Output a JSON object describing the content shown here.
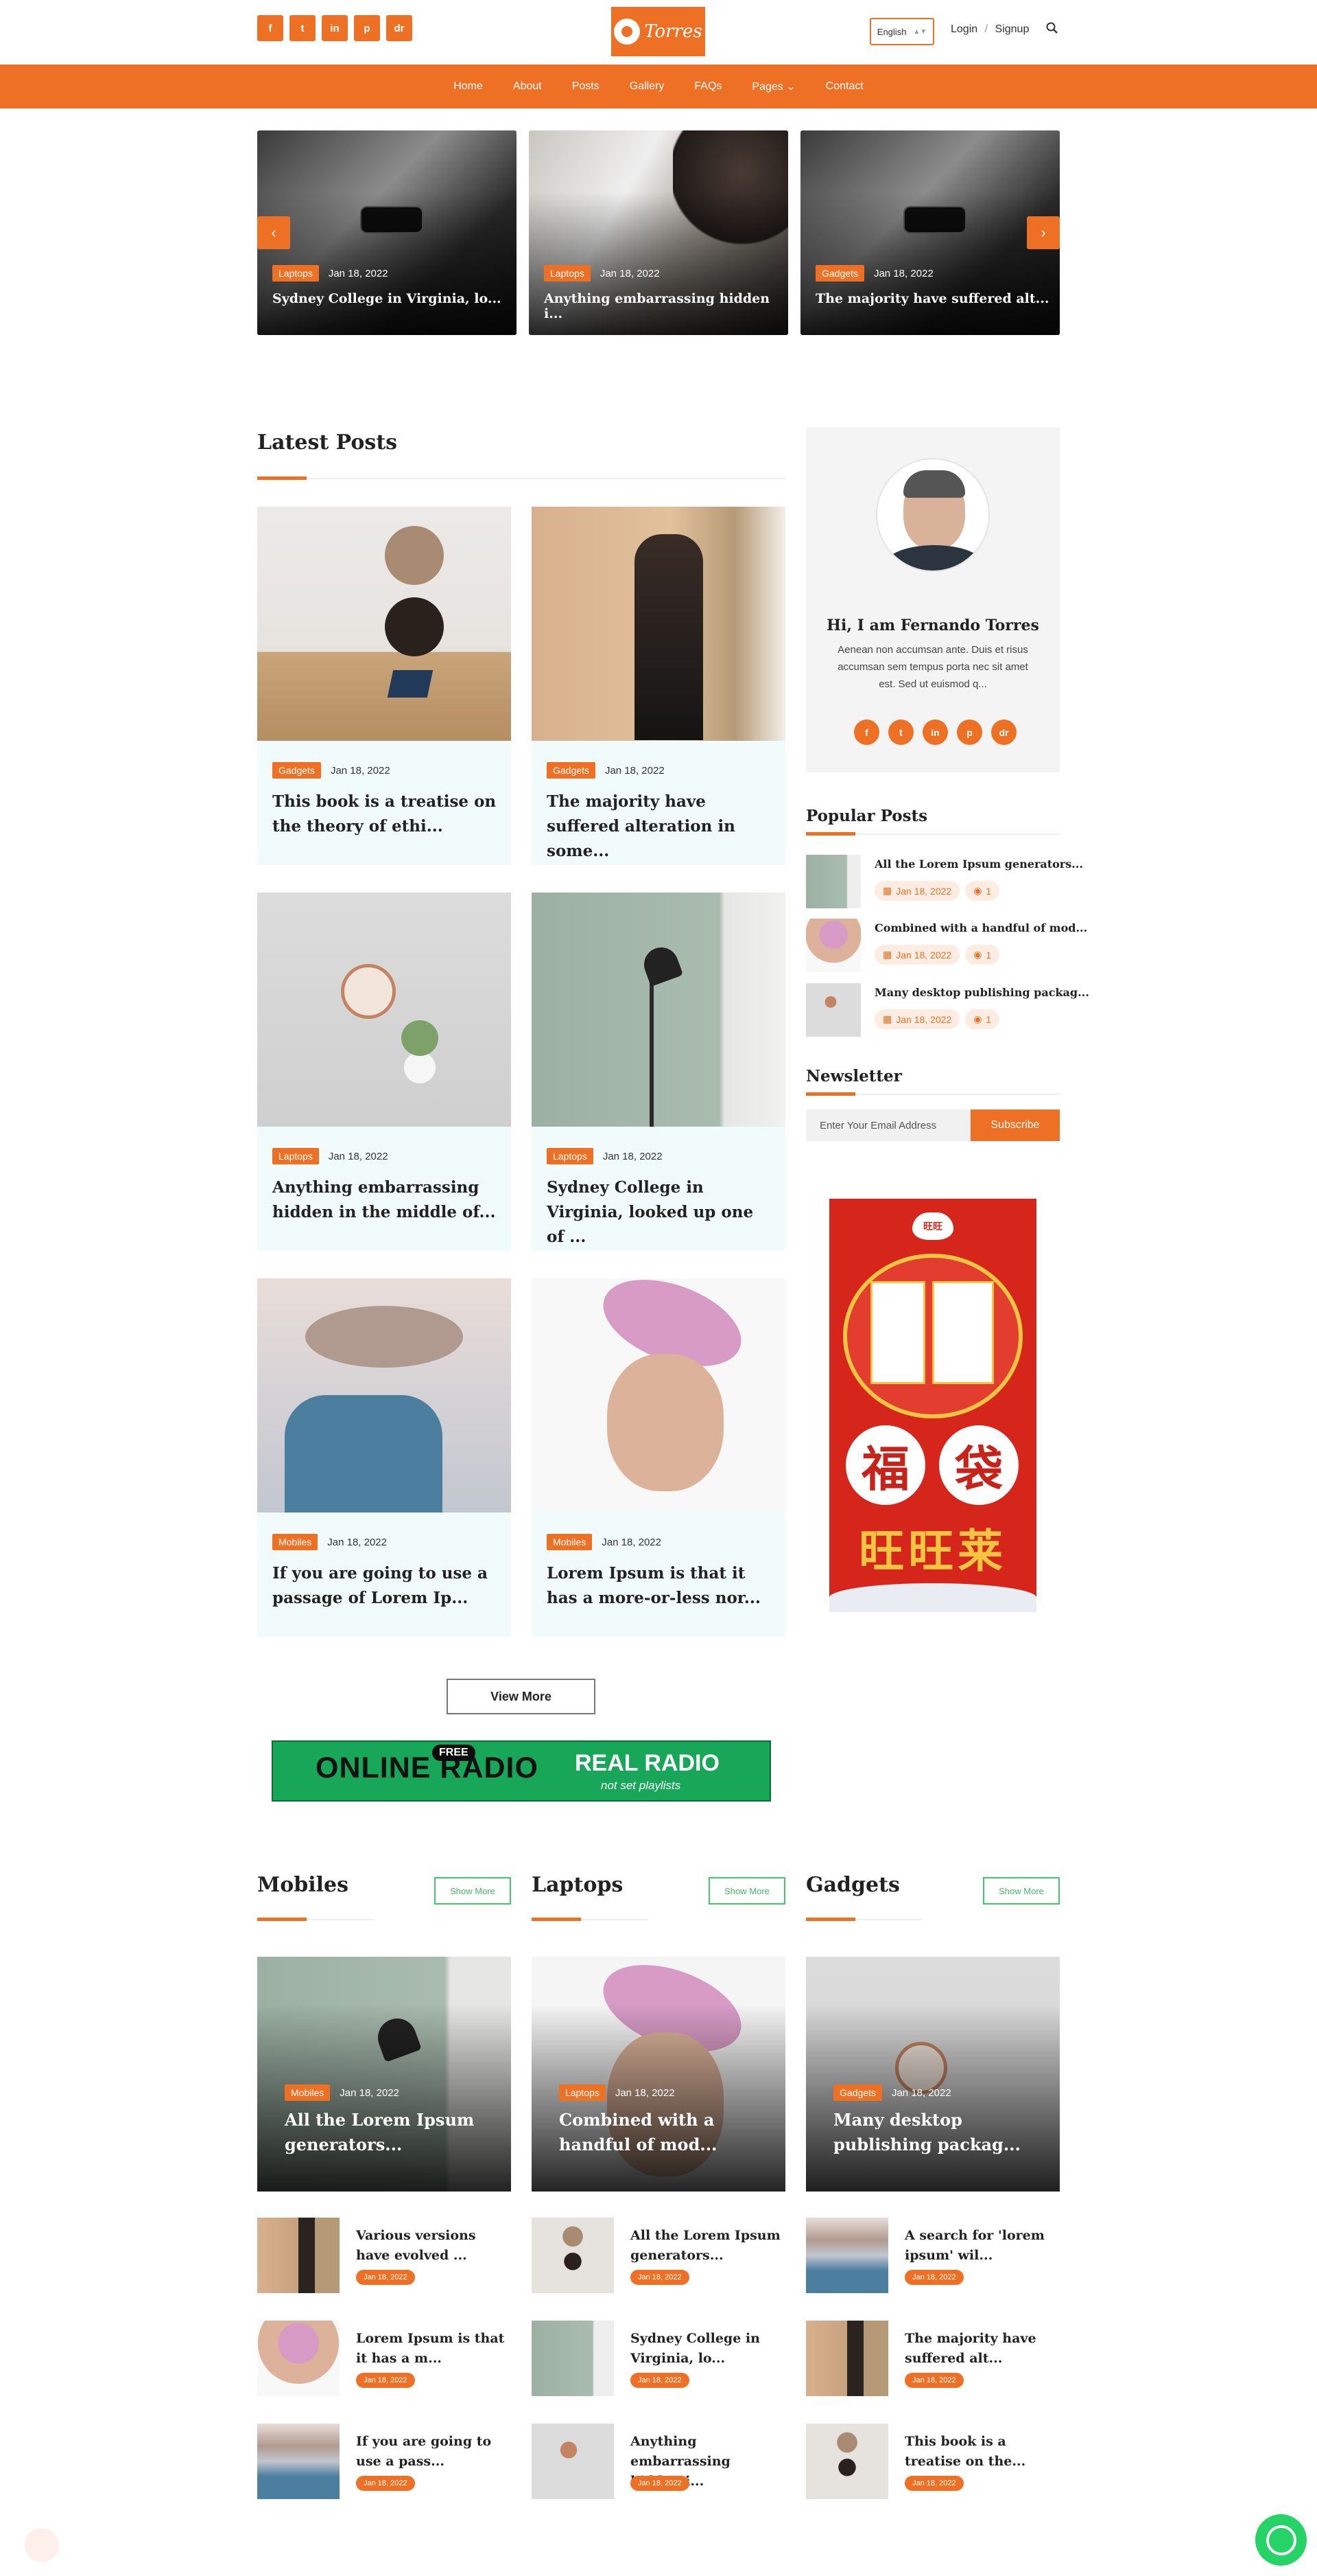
{
  "header": {
    "social": [
      "f",
      "t",
      "in",
      "p",
      "dr"
    ],
    "logo": "Torres",
    "language": "English",
    "login": "Login",
    "separator": "/",
    "signup": "Signup"
  },
  "nav": [
    "Home",
    "About",
    "Posts",
    "Gallery",
    "FAQs",
    "Pages",
    "Contact"
  ],
  "slider": [
    {
      "tag": "Laptops",
      "date": "Jan 18, 2022",
      "title": "Sydney College in Virginia, lo..."
    },
    {
      "tag": "Laptops",
      "date": "Jan 18, 2022",
      "title": "Anything embarrassing hidden i..."
    },
    {
      "tag": "Gadgets",
      "date": "Jan 18, 2022",
      "title": "The majority have suffered alt..."
    }
  ],
  "latest": {
    "title": "Latest Posts",
    "posts": [
      {
        "tag": "Gadgets",
        "date": "Jan 18, 2022",
        "title": "This book is a treatise on the theory of ethi..."
      },
      {
        "tag": "Gadgets",
        "date": "Jan 18, 2022",
        "title": "The majority have suffered alteration in some..."
      },
      {
        "tag": "Laptops",
        "date": "Jan 18, 2022",
        "title": "Anything embarrassing hidden in the middle of..."
      },
      {
        "tag": "Laptops",
        "date": "Jan 18, 2022",
        "title": "Sydney College in Virginia, looked up one of ..."
      },
      {
        "tag": "Mobiles",
        "date": "Jan 18, 2022",
        "title": "If you are going to use a passage of Lorem Ip..."
      },
      {
        "tag": "Mobiles",
        "date": "Jan 18, 2022",
        "title": "Lorem Ipsum is that it has a more-or-less nor..."
      }
    ],
    "view_more": "View More"
  },
  "radio_banner": {
    "free": "FREE",
    "left": "ONLINE RADIO",
    "right": "REAL RADIO",
    "sub": "not set playlists"
  },
  "about": {
    "name": "Hi, I am Fernando Torres",
    "bio": "Aenean non accumsan ante. Duis et risus accumsan sem tempus porta nec sit amet est. Sed ut euismod q..."
  },
  "popular": {
    "title": "Popular Posts",
    "items": [
      {
        "title": "All the Lorem Ipsum generators...",
        "date": "Jan 18, 2022",
        "views": "1"
      },
      {
        "title": "Combined with a handful of mod...",
        "date": "Jan 18, 2022",
        "views": "1"
      },
      {
        "title": "Many desktop publishing packag...",
        "date": "Jan 18, 2022",
        "views": "1"
      }
    ]
  },
  "newsletter": {
    "title": "Newsletter",
    "placeholder": "Enter Your Email Address",
    "button": "Subscribe"
  },
  "ad": {
    "brand": "旺旺",
    "big1": "福",
    "big2": "袋",
    "bottom": "旺旺莱"
  },
  "categories": [
    {
      "title": "Mobiles",
      "show_more": "Show More",
      "featured": {
        "tag": "Mobiles",
        "date": "Jan 18, 2022",
        "title": "All the Lorem Ipsum generators..."
      },
      "items": [
        {
          "title": "Various versions have evolved ...",
          "date": "Jan 18, 2022"
        },
        {
          "title": "Lorem Ipsum is that it has a m...",
          "date": "Jan 18, 2022"
        },
        {
          "title": "If you are going to use a pass...",
          "date": "Jan 18, 2022"
        }
      ]
    },
    {
      "title": "Laptops",
      "show_more": "Show More",
      "featured": {
        "tag": "Laptops",
        "date": "Jan 18, 2022",
        "title": "Combined with a handful of mod..."
      },
      "items": [
        {
          "title": "All the Lorem Ipsum generators...",
          "date": "Jan 18, 2022"
        },
        {
          "title": "Sydney College in Virginia, lo...",
          "date": "Jan 18, 2022"
        },
        {
          "title": "Anything embarrassing hidden i...",
          "date": "Jan 18, 2022"
        }
      ]
    },
    {
      "title": "Gadgets",
      "show_more": "Show More",
      "featured": {
        "tag": "Gadgets",
        "date": "Jan 18, 2022",
        "title": "Many desktop publishing packag..."
      },
      "items": [
        {
          "title": "A search for 'lorem ipsum' wil...",
          "date": "Jan 18, 2022"
        },
        {
          "title": "The majority have suffered alt...",
          "date": "Jan 18, 2022"
        },
        {
          "title": "This book is a treatise on the...",
          "date": "Jan 18, 2022"
        }
      ]
    }
  ],
  "colors": {
    "accent": "#ee7024",
    "green": "#45c66b",
    "card_bg": "#f1fbfc"
  }
}
